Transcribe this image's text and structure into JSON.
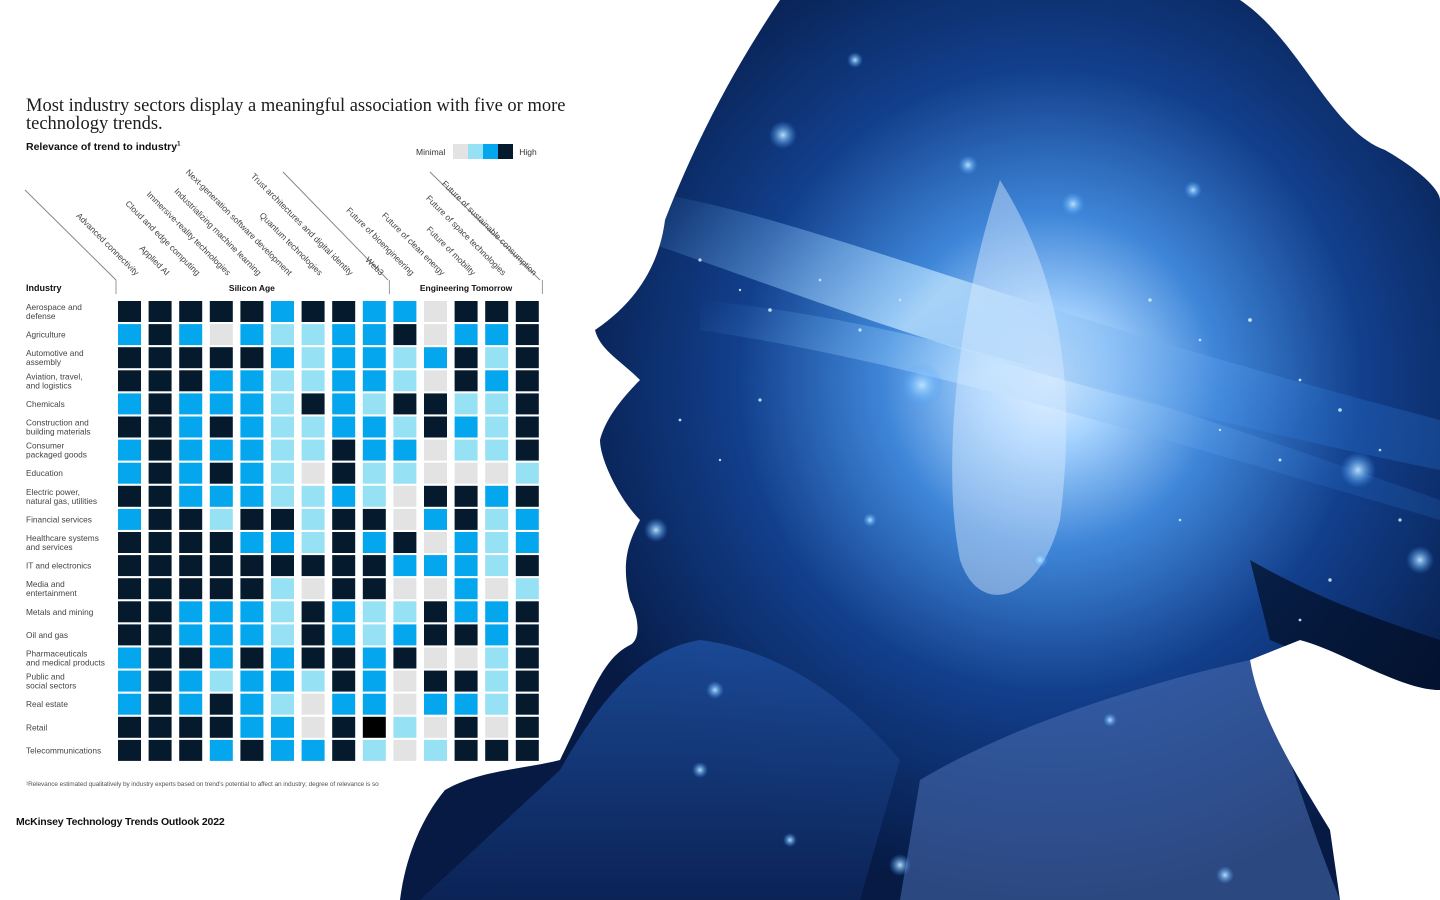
{
  "page": {
    "brand": "McKinsey Technology Trends Outlook 2022"
  },
  "colors": {
    "minimal": "#e3e3e3",
    "low": "#97e1f5",
    "medium": "#04a6ee",
    "high": "#061a2d",
    "retail_web3_special": "#000000"
  },
  "legend": {
    "min_label": "Minimal",
    "max_label": "High",
    "levels": [
      "minimal",
      "low",
      "medium",
      "high"
    ]
  },
  "chart_data": {
    "type": "heatmap",
    "title": "Most industry sectors display a meaningful association with five or more technology trends.",
    "subtitle": "Relevance of trend to industry",
    "subtitle_footnote_marker": "1",
    "scale": "0 = Minimal, 1 = Low, 2 = Medium, 3 = High",
    "row_header": "Industry",
    "groups": [
      {
        "name": "Silicon Age",
        "columns": [
          0,
          1,
          2,
          3,
          4,
          5,
          6,
          7,
          8
        ]
      },
      {
        "name": "Engineering Tomorrow",
        "columns": [
          9,
          10,
          11,
          12,
          13
        ]
      }
    ],
    "columns": [
      "Advanced connectivity",
      "Applied AI",
      "Cloud and edge computing",
      "Immersive-reality technologies",
      "Industrializing machine learning",
      "Next-generation software development",
      "Quantum technologies",
      "Trust architectures and digital identity",
      "Web3",
      "Future of bioengineering",
      "Future of clean energy",
      "Future of mobility",
      "Future of space technologies",
      "Future of sustainable consumption"
    ],
    "rows": [
      {
        "label": [
          "Aerospace and",
          "defense"
        ],
        "values": [
          3,
          3,
          3,
          3,
          3,
          2,
          3,
          3,
          2,
          2,
          0,
          3,
          3,
          3
        ]
      },
      {
        "label": [
          "Agriculture"
        ],
        "values": [
          2,
          3,
          2,
          0,
          2,
          1,
          1,
          2,
          2,
          3,
          0,
          2,
          2,
          3
        ]
      },
      {
        "label": [
          "Automotive and",
          "assembly"
        ],
        "values": [
          3,
          3,
          3,
          3,
          3,
          2,
          1,
          2,
          2,
          1,
          2,
          3,
          1,
          3
        ]
      },
      {
        "label": [
          "Aviation, travel,",
          "and logistics"
        ],
        "values": [
          3,
          3,
          3,
          2,
          2,
          1,
          1,
          2,
          2,
          1,
          0,
          3,
          2,
          3
        ]
      },
      {
        "label": [
          "Chemicals"
        ],
        "values": [
          2,
          3,
          2,
          2,
          2,
          1,
          3,
          2,
          1,
          3,
          3,
          1,
          1,
          3
        ]
      },
      {
        "label": [
          "Construction and",
          "building materials"
        ],
        "values": [
          3,
          3,
          2,
          3,
          2,
          1,
          1,
          2,
          2,
          1,
          3,
          2,
          1,
          3
        ]
      },
      {
        "label": [
          "Consumer",
          "packaged goods"
        ],
        "values": [
          2,
          3,
          2,
          2,
          2,
          1,
          1,
          3,
          2,
          2,
          0,
          1,
          1,
          3
        ]
      },
      {
        "label": [
          "Education"
        ],
        "values": [
          2,
          3,
          2,
          3,
          2,
          1,
          0,
          3,
          1,
          1,
          0,
          0,
          0,
          1
        ]
      },
      {
        "label": [
          "Electric power,",
          "natural gas, utilities"
        ],
        "values": [
          3,
          3,
          2,
          2,
          2,
          1,
          1,
          2,
          1,
          0,
          3,
          3,
          2,
          3
        ]
      },
      {
        "label": [
          "Financial services"
        ],
        "values": [
          2,
          3,
          3,
          1,
          3,
          3,
          1,
          3,
          3,
          0,
          2,
          3,
          1,
          2
        ]
      },
      {
        "label": [
          "Healthcare systems",
          "and services"
        ],
        "values": [
          3,
          3,
          3,
          3,
          2,
          2,
          1,
          3,
          2,
          3,
          0,
          2,
          1,
          2
        ]
      },
      {
        "label": [
          "IT and electronics"
        ],
        "values": [
          3,
          3,
          3,
          3,
          3,
          3,
          3,
          3,
          3,
          2,
          2,
          2,
          1,
          3
        ]
      },
      {
        "label": [
          "Media and",
          "entertainment"
        ],
        "values": [
          3,
          3,
          3,
          3,
          3,
          1,
          0,
          3,
          3,
          0,
          0,
          2,
          0,
          1
        ]
      },
      {
        "label": [
          "Metals and mining"
        ],
        "values": [
          3,
          3,
          2,
          2,
          2,
          1,
          3,
          2,
          1,
          1,
          3,
          2,
          2,
          3
        ]
      },
      {
        "label": [
          "Oil and gas"
        ],
        "values": [
          3,
          3,
          2,
          2,
          2,
          1,
          3,
          2,
          1,
          2,
          3,
          3,
          2,
          3
        ]
      },
      {
        "label": [
          "Pharmaceuticals",
          "and medical products"
        ],
        "values": [
          2,
          3,
          3,
          2,
          3,
          2,
          3,
          3,
          2,
          3,
          0,
          0,
          1,
          3
        ]
      },
      {
        "label": [
          "Public and",
          "social sectors"
        ],
        "values": [
          2,
          3,
          2,
          1,
          2,
          2,
          1,
          3,
          2,
          0,
          3,
          3,
          1,
          3
        ]
      },
      {
        "label": [
          "Real estate"
        ],
        "values": [
          2,
          3,
          2,
          3,
          2,
          1,
          0,
          2,
          2,
          0,
          2,
          2,
          1,
          3
        ]
      },
      {
        "label": [
          "Retail"
        ],
        "values": [
          3,
          3,
          3,
          3,
          2,
          2,
          0,
          3,
          3,
          1,
          0,
          3,
          0,
          3
        ]
      },
      {
        "label": [
          "Telecommunications"
        ],
        "values": [
          3,
          3,
          3,
          2,
          3,
          2,
          2,
          3,
          1,
          0,
          1,
          3,
          3,
          3
        ]
      }
    ],
    "footnote": "¹Relevance estimated qualitatively by industry experts based on trend's potential to affect an industry; degree of relevance is so"
  }
}
